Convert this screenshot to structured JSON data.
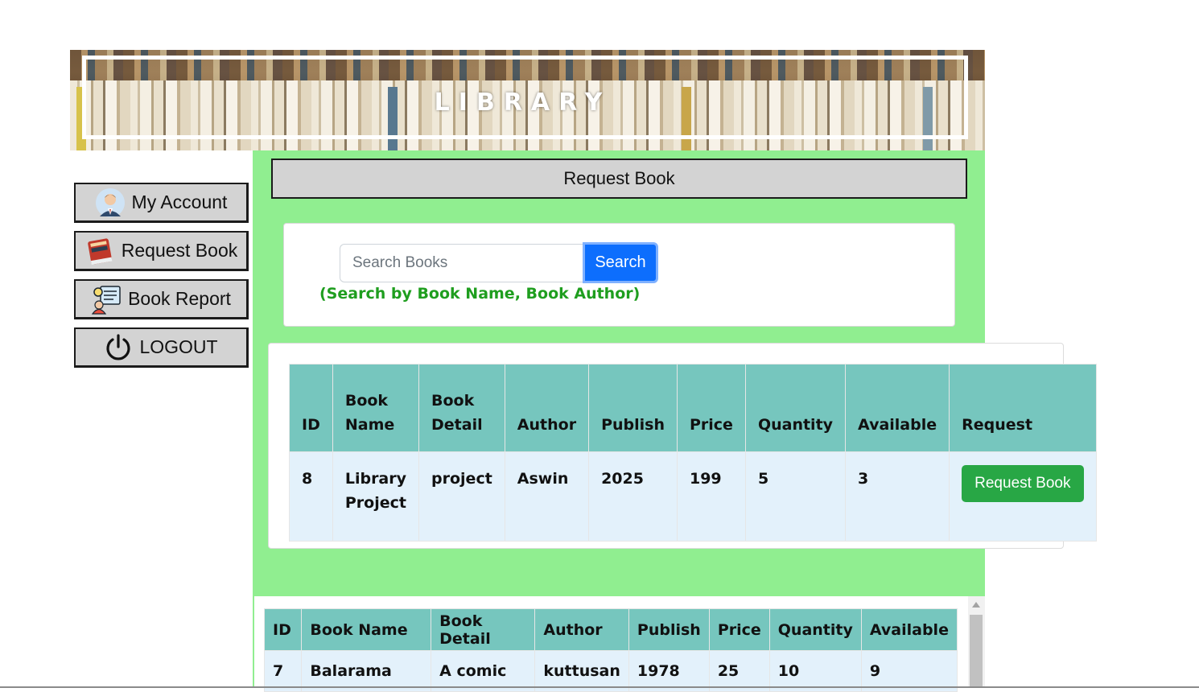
{
  "banner": {
    "title": "LIBRARY"
  },
  "sidebar": {
    "items": [
      {
        "label": "My Account",
        "icon": "user-avatar-icon"
      },
      {
        "label": "Request Book",
        "icon": "book-icon"
      },
      {
        "label": "Book Report",
        "icon": "report-icon"
      },
      {
        "label": "LOGOUT",
        "icon": "power-icon"
      }
    ]
  },
  "main": {
    "section_title": "Request Book",
    "search": {
      "placeholder": "Search Books",
      "button_label": "Search",
      "hint": "(Search by Book Name, Book Author)"
    },
    "results": {
      "headers": [
        "ID",
        "Book Name",
        "Book Detail",
        "Author",
        "Publish",
        "Price",
        "Quantity",
        "Available",
        "Request"
      ],
      "rows": [
        {
          "id": "8",
          "book_name": "Library Project",
          "book_detail": "project",
          "author": "Aswin",
          "publish": "2025",
          "price": "199",
          "quantity": "5",
          "available": "3",
          "request_label": "Request Book"
        }
      ]
    },
    "books": {
      "headers": [
        "ID",
        "Book Name",
        "Book Detail",
        "Author",
        "Publish",
        "Price",
        "Quantity",
        "Available"
      ],
      "rows": [
        {
          "id": "7",
          "book_name": "Balarama",
          "book_detail": "A comic",
          "author": "kuttusan",
          "publish": "1978",
          "price": "25",
          "quantity": "10",
          "available": "9"
        }
      ]
    }
  },
  "colors": {
    "main_bg": "#90ee90",
    "table_header": "#76c6be",
    "table_row": "#e3f1fb",
    "search_button": "#0d6efd",
    "request_button": "#28a745",
    "hint_text": "#1f9e1f"
  }
}
